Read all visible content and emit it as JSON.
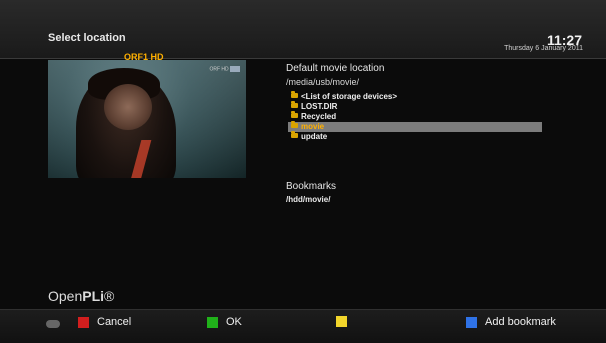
{
  "header": {
    "title": "Select location",
    "time": "11:27",
    "date": "Thursday  6 January 2011"
  },
  "preview": {
    "channel_label": "ORF1 HD",
    "corner_logo": "ORF HD"
  },
  "default_location": {
    "label": "Default movie location",
    "path": "/media/usb/movie/"
  },
  "folders": [
    {
      "label": "<List of storage devices>",
      "selected": false
    },
    {
      "label": "LOST.DIR",
      "selected": false
    },
    {
      "label": "Recycled",
      "selected": false
    },
    {
      "label": "movie",
      "selected": true
    },
    {
      "label": "update",
      "selected": false
    }
  ],
  "bookmarks": {
    "label": "Bookmarks",
    "items": [
      "/hdd/movie/"
    ]
  },
  "brand": {
    "prefix": "Open",
    "suffix": "PLi",
    "mark": "®"
  },
  "footer": {
    "cancel": "Cancel",
    "ok": "OK",
    "add_bookmark": "Add bookmark"
  },
  "colors": {
    "accent": "#ffb000",
    "red": "#d21e1e",
    "green": "#20b11a",
    "yellow": "#f2d52b",
    "blue": "#2f72e6",
    "selection_bg": "#7c7c7c"
  },
  "icons": {
    "folder": "folder-icon",
    "remote": "remote-icon"
  }
}
